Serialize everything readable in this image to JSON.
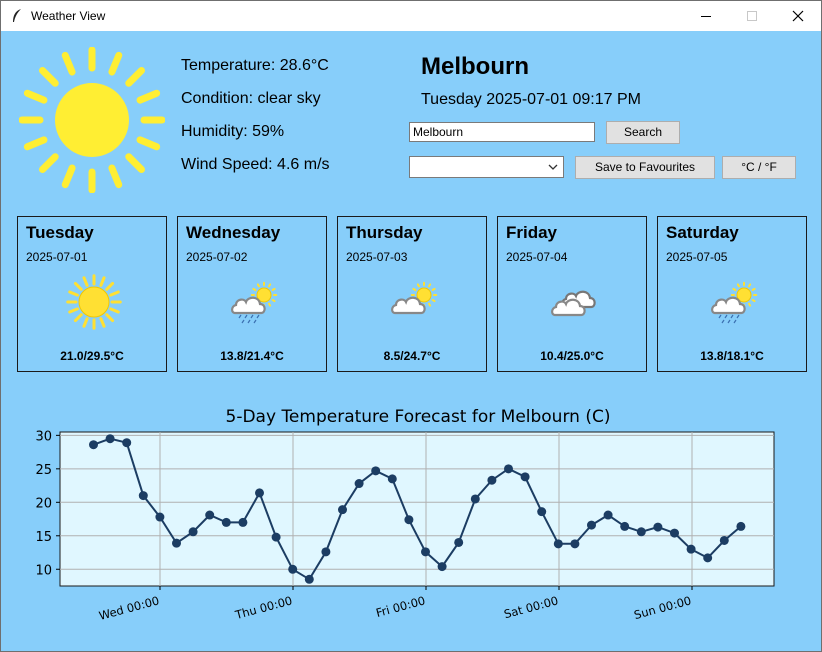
{
  "window": {
    "title": "Weather View"
  },
  "current": {
    "city": "Melbourn",
    "datetime": "Tuesday 2025-07-01 09:17 PM",
    "temperature": "Temperature: 28.6°C",
    "condition": "Condition: clear sky",
    "humidity": "Humidity: 59%",
    "wind": "Wind Speed: 4.6 m/s",
    "icon": "sun-icon"
  },
  "search": {
    "value": "Melbourn",
    "button": "Search"
  },
  "favourites": {
    "selected": "",
    "save_button": "Save to Favourites",
    "unit_button": "°C / °F"
  },
  "forecast": [
    {
      "day": "Tuesday",
      "date": "2025-07-01",
      "temps": "21.0/29.5°C",
      "icon": "sun-icon"
    },
    {
      "day": "Wednesday",
      "date": "2025-07-02",
      "temps": "13.8/21.4°C",
      "icon": "sun-cloud-rain-icon"
    },
    {
      "day": "Thursday",
      "date": "2025-07-03",
      "temps": "8.5/24.7°C",
      "icon": "sun-cloud-icon"
    },
    {
      "day": "Friday",
      "date": "2025-07-04",
      "temps": "10.4/25.0°C",
      "icon": "cloud-icon"
    },
    {
      "day": "Saturday",
      "date": "2025-07-05",
      "temps": "13.8/18.1°C",
      "icon": "sun-cloud-rain-icon"
    }
  ],
  "chart_data": {
    "type": "line",
    "title": "5-Day Temperature Forecast for Melbourn (C)",
    "xlabel": "",
    "ylabel": "",
    "grid": true,
    "yticks": [
      "10",
      "15",
      "20",
      "25",
      "30"
    ],
    "ylim": [
      7.5,
      30.5
    ],
    "xticks": [
      "Wed 00:00",
      "Thu 00:00",
      "Fri 00:00",
      "Sat 00:00",
      "Sun 00:00"
    ],
    "series": [
      {
        "values": [
          28.6,
          29.5,
          28.9,
          21.0,
          17.8,
          13.9,
          15.6,
          18.1,
          17.0,
          17.0,
          21.4,
          14.8,
          10.0,
          8.5,
          12.6,
          18.9,
          22.8,
          24.7,
          23.5,
          17.4,
          12.6,
          10.4,
          14.0,
          20.5,
          23.3,
          25.0,
          23.8,
          18.6,
          13.8,
          13.8,
          16.6,
          18.1,
          16.4,
          15.6,
          16.3,
          15.4,
          13.0,
          11.7,
          14.3,
          16.4
        ]
      }
    ]
  }
}
